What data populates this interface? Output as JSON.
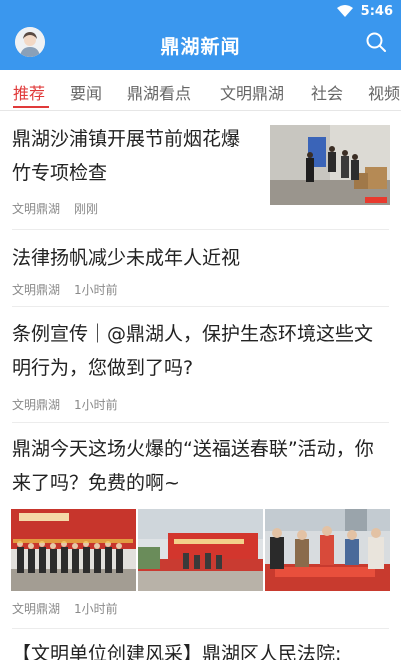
{
  "status_bar": {
    "time": "5:46"
  },
  "header": {
    "title": "鼎湖新闻"
  },
  "tabs": [
    "推荐",
    "要闻",
    "鼎湖看点",
    "文明鼎湖",
    "社会",
    "视频"
  ],
  "articles": [
    {
      "title_line1": "鼎湖沙浦镇开展节前烟花爆",
      "title_line2": "竹专项检查",
      "source": "文明鼎湖",
      "time": "刚刚"
    },
    {
      "title_line1": "法律扬帆减少未成年人近视",
      "source": "文明鼎湖",
      "time": "1小时前"
    },
    {
      "title_line1": "条例宣传｜@鼎湖人，保护生态环境这些文",
      "title_line2": "明行为，您做到了吗?",
      "source": "文明鼎湖",
      "time": "1小时前"
    },
    {
      "title_line1": "鼎湖今天这场火爆的“送福送春联”活动，你",
      "title_line2": "来了吗？免费的啊~",
      "source": "文明鼎湖",
      "time": "1小时前"
    },
    {
      "title_line1": "【文明单位创建风采】鼎湖区人民法院:"
    }
  ]
}
